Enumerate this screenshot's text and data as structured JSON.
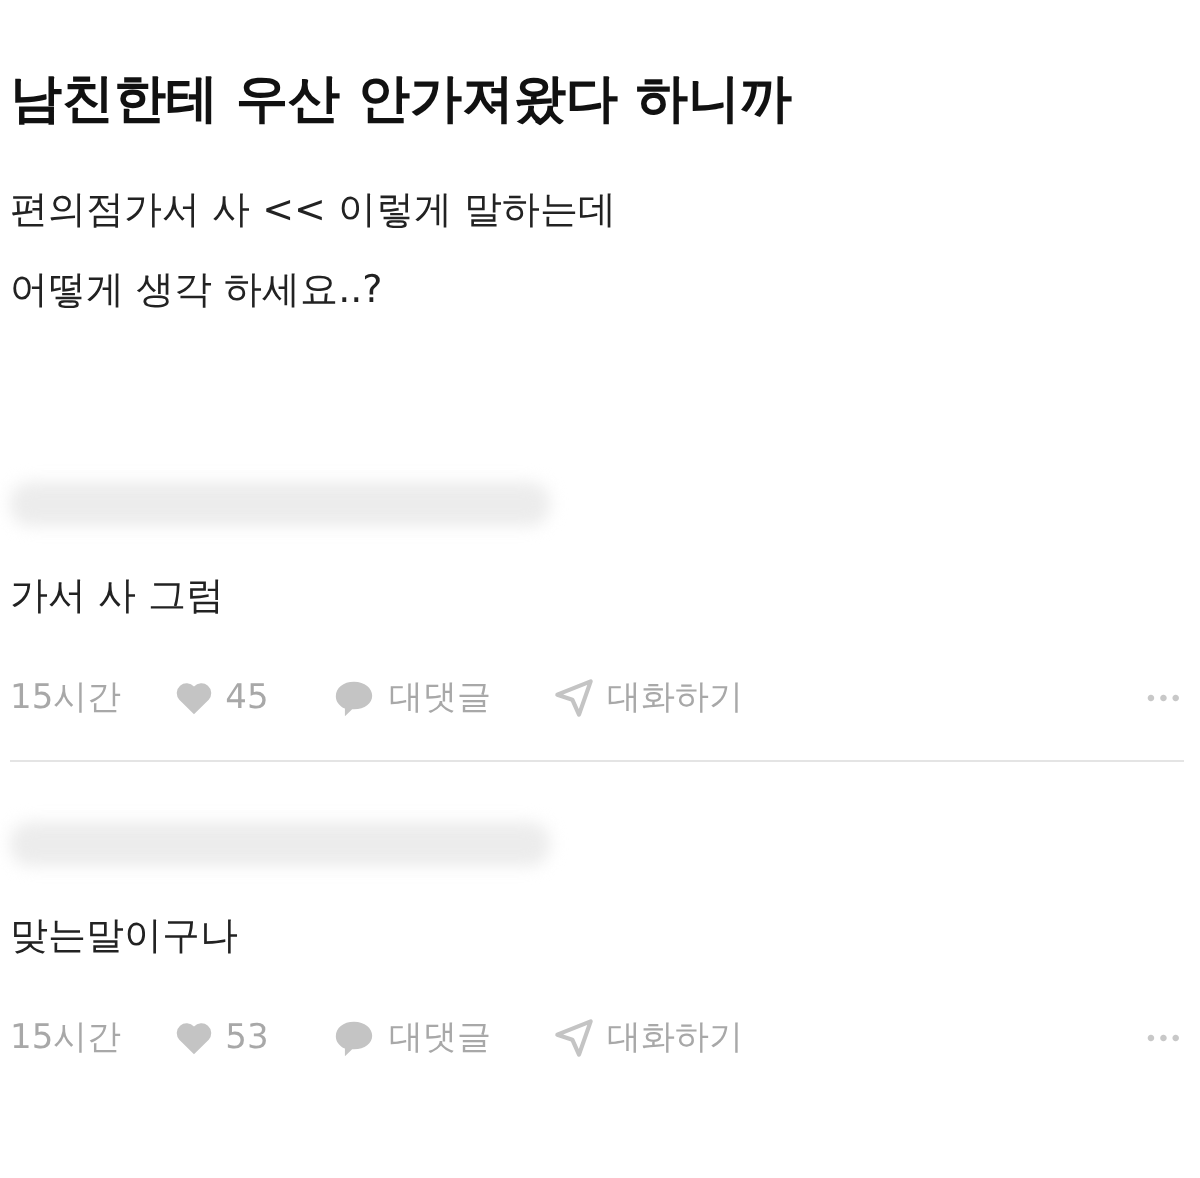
{
  "post": {
    "title": "남친한테 우산 안가져왔다 하니까",
    "body_lines": [
      "편의점가서 사 << 이렇게 말하는데",
      "어떻게 생각 하세요..?"
    ]
  },
  "comments": [
    {
      "text": "가서 사 그럼",
      "time": "15시간",
      "likes": "45",
      "reply_label": "대댓글",
      "chat_label": "대화하기",
      "more": "•••"
    },
    {
      "text": "맞는말이구나",
      "time": "15시간",
      "likes": "53",
      "reply_label": "대댓글",
      "chat_label": "대화하기",
      "more": "•••"
    }
  ]
}
